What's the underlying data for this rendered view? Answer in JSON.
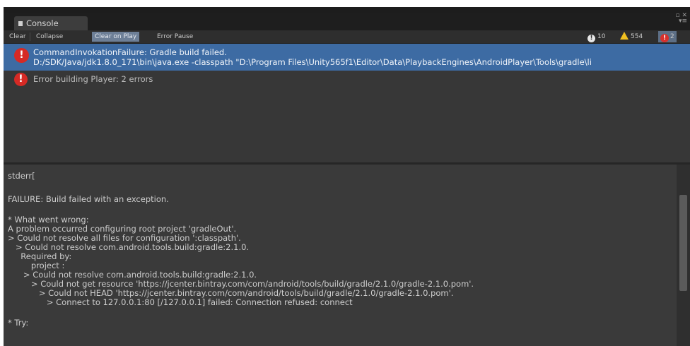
{
  "tab": {
    "title": "Console"
  },
  "toolbar": {
    "buttons": [
      "Clear",
      "Collapse",
      "Clear on Play",
      "Error Pause"
    ],
    "counts": {
      "info": "10",
      "warnings": "554",
      "errors": "2"
    }
  },
  "log": {
    "entries": [
      {
        "line1": "CommandInvokationFailure: Gradle build failed.",
        "line2": "D:/SDK/Java/jdk1.8.0_171\\bin\\java.exe -classpath \"D:\\Program Files\\Unity565f1\\Editor\\Data\\PlaybackEngines\\AndroidPlayer\\Tools\\gradle\\li"
      },
      {
        "line1": "Error building Player: 2 errors"
      }
    ]
  },
  "detail": {
    "lines": [
      "stderr[",
      "",
      "FAILURE: Build failed with an exception.",
      "",
      "* What went wrong:",
      "A problem occurred configuring root project 'gradleOut'.",
      "> Could not resolve all files for configuration ':classpath'.",
      "   > Could not resolve com.android.tools.build:gradle:2.1.0.",
      "     Required by:",
      "         project :",
      "      > Could not resolve com.android.tools.build:gradle:2.1.0.",
      "         > Could not get resource 'https://jcenter.bintray.com/com/android/tools/build/gradle/2.1.0/gradle-2.1.0.pom'.",
      "            > Could not HEAD 'https://jcenter.bintray.com/com/android/tools/build/gradle/2.1.0/gradle-2.1.0.pom'.",
      "               > Connect to 127.0.0.1:80 [/127.0.0.1] failed: Connection refused: connect",
      "",
      "* Try:"
    ]
  }
}
